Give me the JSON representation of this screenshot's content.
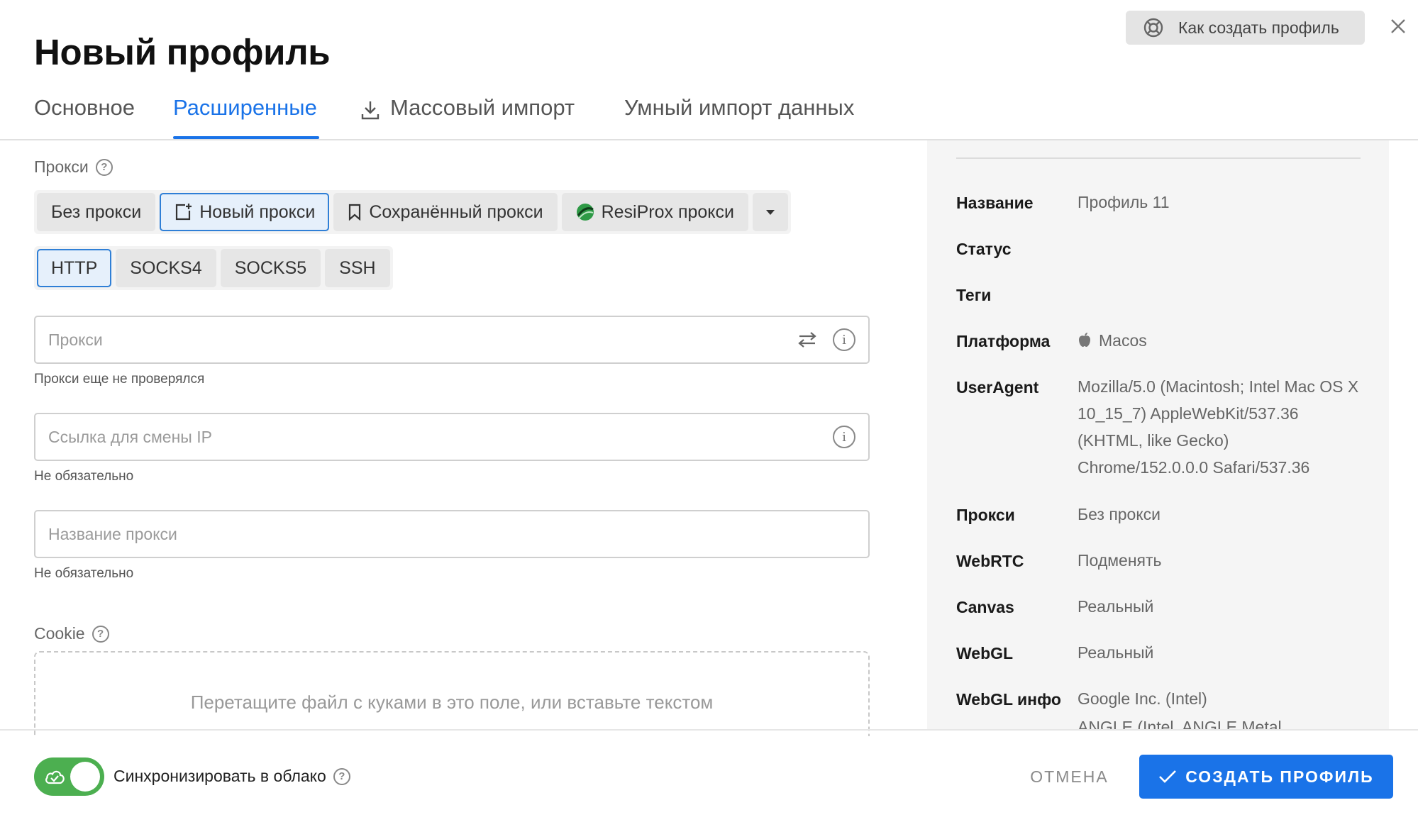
{
  "header": {
    "title": "Новый профиль",
    "help_label": "Как создать профиль"
  },
  "tabs": [
    {
      "label": "Основное"
    },
    {
      "label": "Расширенные",
      "active": true
    },
    {
      "label": "Массовый импорт",
      "icon": "download-icon"
    },
    {
      "label": "Умный импорт данных"
    }
  ],
  "proxy": {
    "section_label": "Прокси",
    "modes": [
      "Без прокси",
      "Новый прокси",
      "Сохранённый прокси",
      "ResiProx прокси"
    ],
    "active_mode": "Новый прокси",
    "types": [
      "HTTP",
      "SOCKS4",
      "SOCKS5",
      "SSH"
    ],
    "active_type": "HTTP",
    "proxy_placeholder": "Прокси",
    "proxy_hint": "Прокси еще не проверялся",
    "ip_link_placeholder": "Ссылка для смены IP",
    "ip_link_hint": "Не обязательно",
    "name_placeholder": "Название прокси",
    "name_hint": "Не обязательно"
  },
  "cookie": {
    "section_label": "Cookie",
    "dropzone_text": "Перетащите файл с куками в это поле, или вставьте текстом"
  },
  "summary": [
    {
      "key": "Название",
      "value": "Профиль 11"
    },
    {
      "key": "Статус",
      "value": ""
    },
    {
      "key": "Теги",
      "value": ""
    },
    {
      "key": "Платформа",
      "value": "Macos",
      "icon": "apple-icon"
    },
    {
      "key": "UserAgent",
      "value": "Mozilla/5.0 (Macintosh; Intel Mac OS X 10_15_7) AppleWebKit/537.36 (KHTML, like Gecko) Chrome/152.0.0.0 Safari/537.36"
    },
    {
      "key": "Прокси",
      "value": "Без прокси"
    },
    {
      "key": "WebRTC",
      "value": "Подменять"
    },
    {
      "key": "Canvas",
      "value": "Реальный"
    },
    {
      "key": "WebGL",
      "value": "Реальный"
    },
    {
      "key": "WebGL инфо",
      "value": "Google Inc. (Intel)"
    },
    {
      "key": "",
      "value": "ANGLE (Intel, ANGLE Metal"
    }
  ],
  "footer": {
    "sync_label": "Синхронизировать в облако",
    "sync_on": true,
    "cancel_label": "ОТМЕНА",
    "create_label": "СОЗДАТЬ ПРОФИЛЬ"
  },
  "colors": {
    "accent": "#1a73e8",
    "toggle_on": "#4caf50"
  }
}
